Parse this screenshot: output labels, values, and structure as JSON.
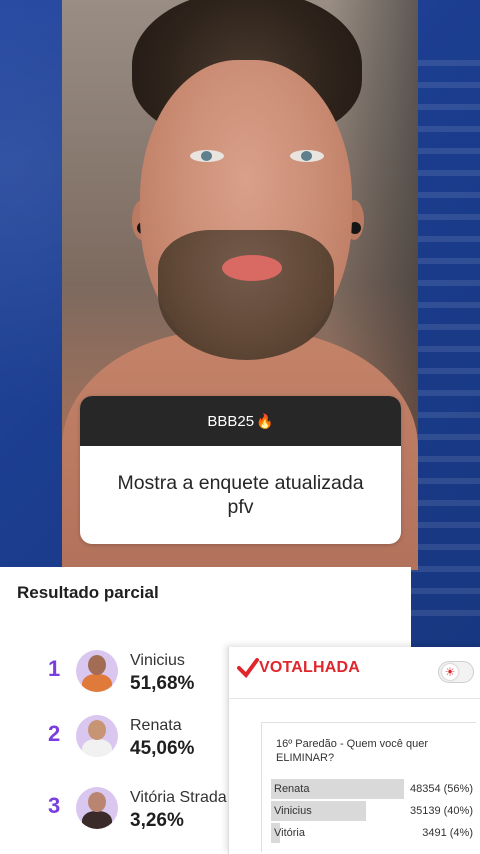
{
  "story": {
    "question_box": {
      "header": "BBB25",
      "header_emoji": "🔥",
      "body": "Mostra a enquete atualizada pfv"
    }
  },
  "results": {
    "title": "Resultado parcial",
    "candidates": [
      {
        "rank": "1",
        "name": "Vinicius",
        "percent": "51,68%"
      },
      {
        "rank": "2",
        "name": "Renata",
        "percent": "45,06%"
      },
      {
        "rank": "3",
        "name": "Vitória Strada",
        "percent": "3,26%"
      }
    ]
  },
  "votalhada": {
    "logo_text": "VOTALHADA",
    "poll_question": "16º Paredão - Quem você quer ELIMINAR?",
    "options": [
      {
        "label": "Renata",
        "value": "48354 (56%)",
        "share": 0.56
      },
      {
        "label": "Vinicius",
        "value": "35139 (40%)",
        "share": 0.4
      },
      {
        "label": "Vitória",
        "value": "3491 (4%)",
        "share": 0.04
      }
    ]
  },
  "colors": {
    "rank": "#7a3ee0",
    "brand_red": "#e0262c",
    "background_blue": "#1b3c8c"
  }
}
